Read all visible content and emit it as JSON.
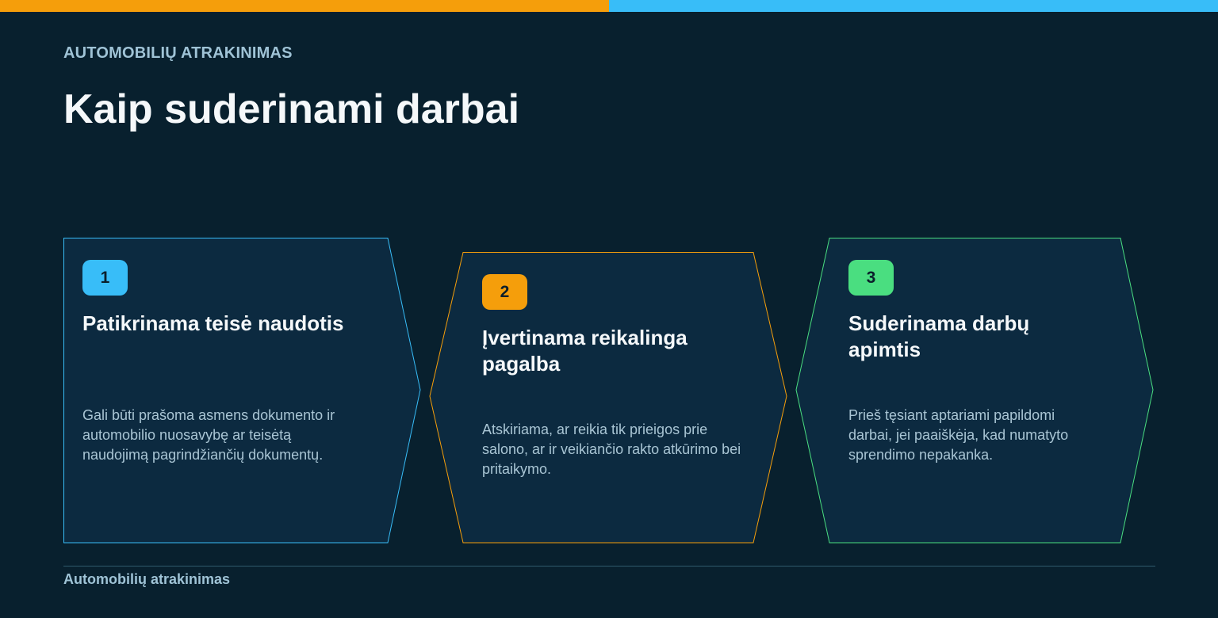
{
  "colors": {
    "background": "#08202e",
    "card_fill": "#0c2a40",
    "accent_blue": "#38bdf8",
    "accent_orange": "#f59e0b",
    "accent_green": "#4ade80"
  },
  "header": {
    "eyebrow": "AUTOMOBILIŲ ATRAKINIMAS",
    "title": "Kaip suderinami darbai"
  },
  "steps": [
    {
      "number": "1",
      "title": "Patikrinama teisė naudotis",
      "description": "Gali būti prašoma asmens dokumento ir automobilio nuosavybę ar teisėtą naudojimą pagrindžiančių dokumentų.",
      "color": "#38bdf8"
    },
    {
      "number": "2",
      "title": "Įvertinama reikalinga pagalba",
      "description": "Atskiriama, ar reikia tik prieigos prie salono, ar ir veikiančio rakto atkūrimo bei pritaikymo.",
      "color": "#f59e0b"
    },
    {
      "number": "3",
      "title": "Suderinama darbų apimtis",
      "description": "Prieš tęsiant aptariami papildomi darbai, jei paaiškėja, kad numatyto sprendimo nepakanka.",
      "color": "#4ade80"
    }
  ],
  "footer": {
    "label": "Automobilių atrakinimas"
  }
}
